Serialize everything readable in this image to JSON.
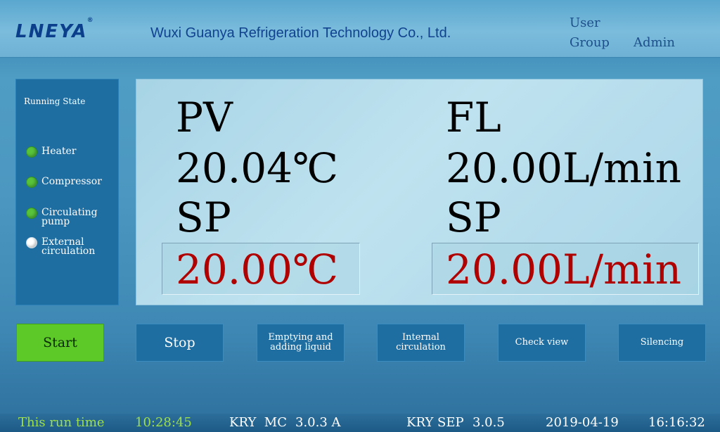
{
  "header": {
    "logo_text": "LNEYA",
    "logo_mark": "®",
    "company_name": "Wuxi Guanya Refrigeration Technology Co., Ltd.",
    "user_label": "User",
    "group_label": "Group",
    "group_value": "Admin"
  },
  "running_state": {
    "title": "Running State",
    "items": [
      {
        "label": "Heater",
        "status": "on"
      },
      {
        "label": "Compressor",
        "status": "on"
      },
      {
        "label": "Circulating pump",
        "status": "on"
      },
      {
        "label": "External circulation",
        "status": "off"
      }
    ],
    "colors": {
      "on": "#57c23a",
      "off": "#ffffff"
    }
  },
  "display": {
    "temperature": {
      "pv_label": "PV",
      "pv_value": "20.04℃",
      "sp_label": "SP",
      "sp_value": "20.00℃"
    },
    "flow": {
      "fl_label": "FL",
      "fl_value": "20.00L/min",
      "sp_label": "SP",
      "sp_value": "20.00L/min"
    },
    "setpoint_color": "#b00000"
  },
  "buttons": {
    "start": "Start",
    "stop": "Stop",
    "emptying": "Emptying and adding liquid",
    "internal": "Internal circulation",
    "check_view": "Check view",
    "silencing": "Silencing"
  },
  "status_bar": {
    "run_time_label": "This run time",
    "run_time_value": "10:28:45",
    "mc_label": "KRY  MC",
    "mc_version": "3.0.3 A",
    "sep_label": "KRY SEP",
    "sep_version": "3.0.5",
    "date": "2019-04-19",
    "time": "16:16:32"
  }
}
